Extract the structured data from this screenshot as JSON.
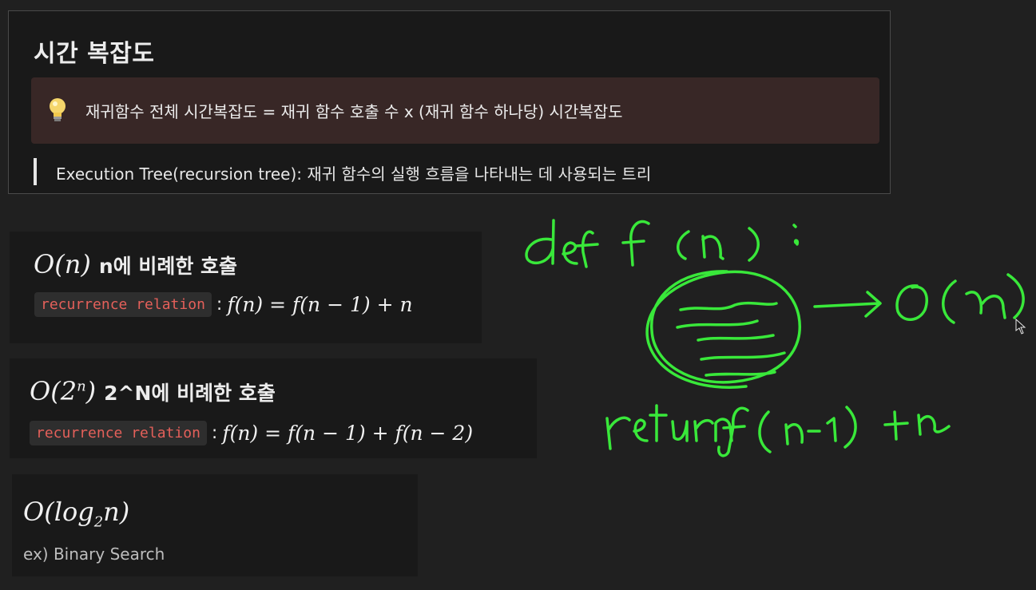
{
  "panel": {
    "title": "시간 복잡도",
    "callout_icon": "lightbulb-icon",
    "callout_text": "재귀함수 전체 시간복잡도 = 재귀 함수 호출 수 x (재귀 함수 하나당) 시간복잡도",
    "quote_text": "Execution Tree(recursion tree): 재귀 함수의 실행 흐름을 나타내는 데 사용되는 트리"
  },
  "blocks": [
    {
      "complexity": "O(n)",
      "label": "n에 비례한 호출",
      "code_label": "recurrence relation",
      "formula": "f(n) = f(n − 1) + n"
    },
    {
      "complexity_prefix": "O(2",
      "complexity_sup": "n",
      "complexity_suffix": ")",
      "label": "2^N에 비례한 호출",
      "code_label": "recurrence relation",
      "formula": "f(n) = f(n − 1) + f(n − 2)"
    },
    {
      "complexity_prefix": "O(log",
      "complexity_sub": "2",
      "complexity_suffix": "n)",
      "example": "ex) Binary Search"
    }
  ],
  "colors": {
    "background": "#202020",
    "panel": "#191919",
    "callout": "#382726",
    "code_text": "#e4605a",
    "ink": "#39e83a"
  }
}
